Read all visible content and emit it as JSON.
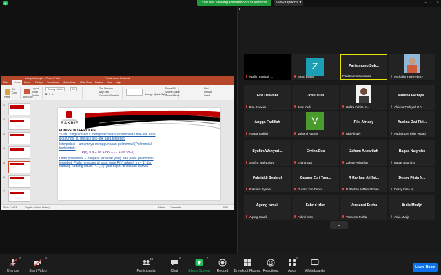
{
  "banner": {
    "viewing_text": "You are viewing Pariatmono Sukamdi's screen",
    "view_options_label": "View Options",
    "view_options_caret": "▾"
  },
  "colors": {
    "zoom_bg": "#1a1a1a",
    "tile_bg": "#232323",
    "banner_green": "#1f9a3a",
    "leave_blue": "#0e72ed",
    "muted_red": "#e04545",
    "share_green": "#1fbf5a",
    "ppt_red": "#b7472a",
    "highlight_yellow": "#e6e600"
  },
  "shared_screen": {
    "app": "PowerPoint",
    "title_file": "Interpolasi.pptx - PowerPoint",
    "title_user": "Pariatmono Sukamdi",
    "tabs": [
      "File",
      "Home",
      "Insert",
      "Design",
      "Transitions",
      "Animations",
      "Slide Show",
      "Review",
      "View",
      "Help"
    ],
    "ribbon": {
      "clipboard": [
        "Paste",
        "Cut",
        "Copy"
      ],
      "slides": [
        "New Slide",
        "Layout",
        "Reset",
        "Section"
      ],
      "font": [
        "Century Gothic",
        "18"
      ],
      "paragraph": [
        "Text Direction",
        "Align Text",
        "Convert to SmartArt"
      ],
      "drawing": [
        "Arrange",
        "Quick Styles",
        "Shape Fill",
        "Shape Outline",
        "Shape Effects"
      ],
      "editing": [
        "Find",
        "Replace",
        "Select"
      ]
    },
    "thumbnail_numbers": [
      "1",
      "2",
      "3",
      "4",
      "5",
      "6",
      "7"
    ],
    "slide": {
      "logo_univ": "UNIVERSITAS",
      "logo_name": "BAKRIE",
      "heading": "FUNGSI INTERPOLASI",
      "p1": "Suatu fungsi disebut menginterpolasi sekumpulan titik-titik data jika fungsi itu melalui titik-titik data tersebut.",
      "p2": "Interpolasi – umumnya menggunakan polinomial (Polinomial – berbentuk:",
      "formula": "P(x) = a + bx + cx² + ⋯ + ax^(n−1)",
      "p3": "Orde polinomial – pangkat terbesar yang ada pada polinomial tersebut. Pada rumusan di atas, orde P(x) adalah (n − 1) dan kadang-kadang ditulis Pₙ₋₁(x), jadi dapat dikatakan bahwa"
    },
    "status": {
      "slide_of": "Slide 7 of 18",
      "language": "English (United States)",
      "notes": "Notes",
      "comments": "Comments",
      "zoom": "64%"
    }
  },
  "participants_gallery": [
    {
      "display": "",
      "label": "Nurfitri Fairiyah ...",
      "type": "video"
    },
    {
      "display": "Z",
      "label": "zoom bsa04",
      "type": "avatar",
      "color": "#1a9fb5"
    },
    {
      "display": "Pariatmono  Suk...",
      "label": "Pariatmono Sukamdo",
      "type": "name",
      "highlight": true
    },
    {
      "display": "",
      "label": "Nurhalim Yogi Febrizy",
      "type": "photo"
    },
    {
      "display": "Eka Deavani",
      "label": "Eka Deavani",
      "type": "name"
    },
    {
      "display": "Jose Yudi",
      "label": "Jose Yudi",
      "type": "name"
    },
    {
      "display": "",
      "label": "Hafiza Fahira S...",
      "type": "photo2"
    },
    {
      "display": "Aldiena  Fathiya...",
      "label": "Aldiena Fathiyah R A",
      "type": "name"
    },
    {
      "display": "Angga Fadillah",
      "label": "Angga Fadillah",
      "type": "name"
    },
    {
      "display": "V",
      "label": "Valyanti Agustin",
      "type": "avatar",
      "color": "#4a9a2e"
    },
    {
      "display": "Riki Afriady",
      "label": "Riki Afriady",
      "type": "name"
    },
    {
      "display": "Audina  Dwi  Firi...",
      "label": "Audina Dwi Firiel Widad",
      "type": "name"
    },
    {
      "display": "Syafira  Wahyuri...",
      "label": "Syafira Wahyuriarti",
      "type": "name"
    },
    {
      "display": "Ervina Eva",
      "label": "Ervina Eva",
      "type": "name"
    },
    {
      "display": "Zaham Akbarilah",
      "label": "Zaham Akbarilah",
      "type": "name"
    },
    {
      "display": "Bagas Nugroho",
      "label": "Bagas Nugroho",
      "type": "name"
    },
    {
      "display": "Fahrialdi Syahrul",
      "label": "Fahrialdi Syahrul",
      "type": "name"
    },
    {
      "display": "Gusam Zuri Tam...",
      "label": "Gusam Zuri Tamsir",
      "type": "name"
    },
    {
      "display": "R Rayhan Aliffat...",
      "label": "R Rayhan Aliffaturahman",
      "type": "name"
    },
    {
      "display": "Dessy Fitria N...",
      "label": "Dessy Fitria N.",
      "type": "name"
    },
    {
      "display": "Agung Ismail",
      "label": "Agung Ismail",
      "type": "name"
    },
    {
      "display": "Fahrul Irfan",
      "label": "Fahrul Irfan",
      "type": "name"
    },
    {
      "display": "Vensensi Purba",
      "label": "Vensensi Purba",
      "type": "name"
    },
    {
      "display": "Aulia Mudjri",
      "label": "Aulia Mudjri",
      "type": "name"
    }
  ],
  "gallery_pager": "⌄",
  "toolbar": {
    "unmute": "Unmute",
    "start_video": "Start Video",
    "participants": "Participants",
    "participants_count": "34",
    "chat": "Chat",
    "share_screen": "Share Screen",
    "record": "Record",
    "breakout": "Breakout Rooms",
    "reactions": "Reactions",
    "apps": "Apps",
    "whiteboards": "Whiteboards",
    "leave": "Leave Room",
    "caret": "^"
  },
  "icons": [
    "shield-icon",
    "microphone-muted-icon",
    "video-off-icon",
    "participants-icon",
    "chat-icon",
    "share-screen-icon",
    "record-icon",
    "breakout-rooms-icon",
    "reactions-icon",
    "apps-icon",
    "whiteboards-icon",
    "chevron-down-icon"
  ]
}
